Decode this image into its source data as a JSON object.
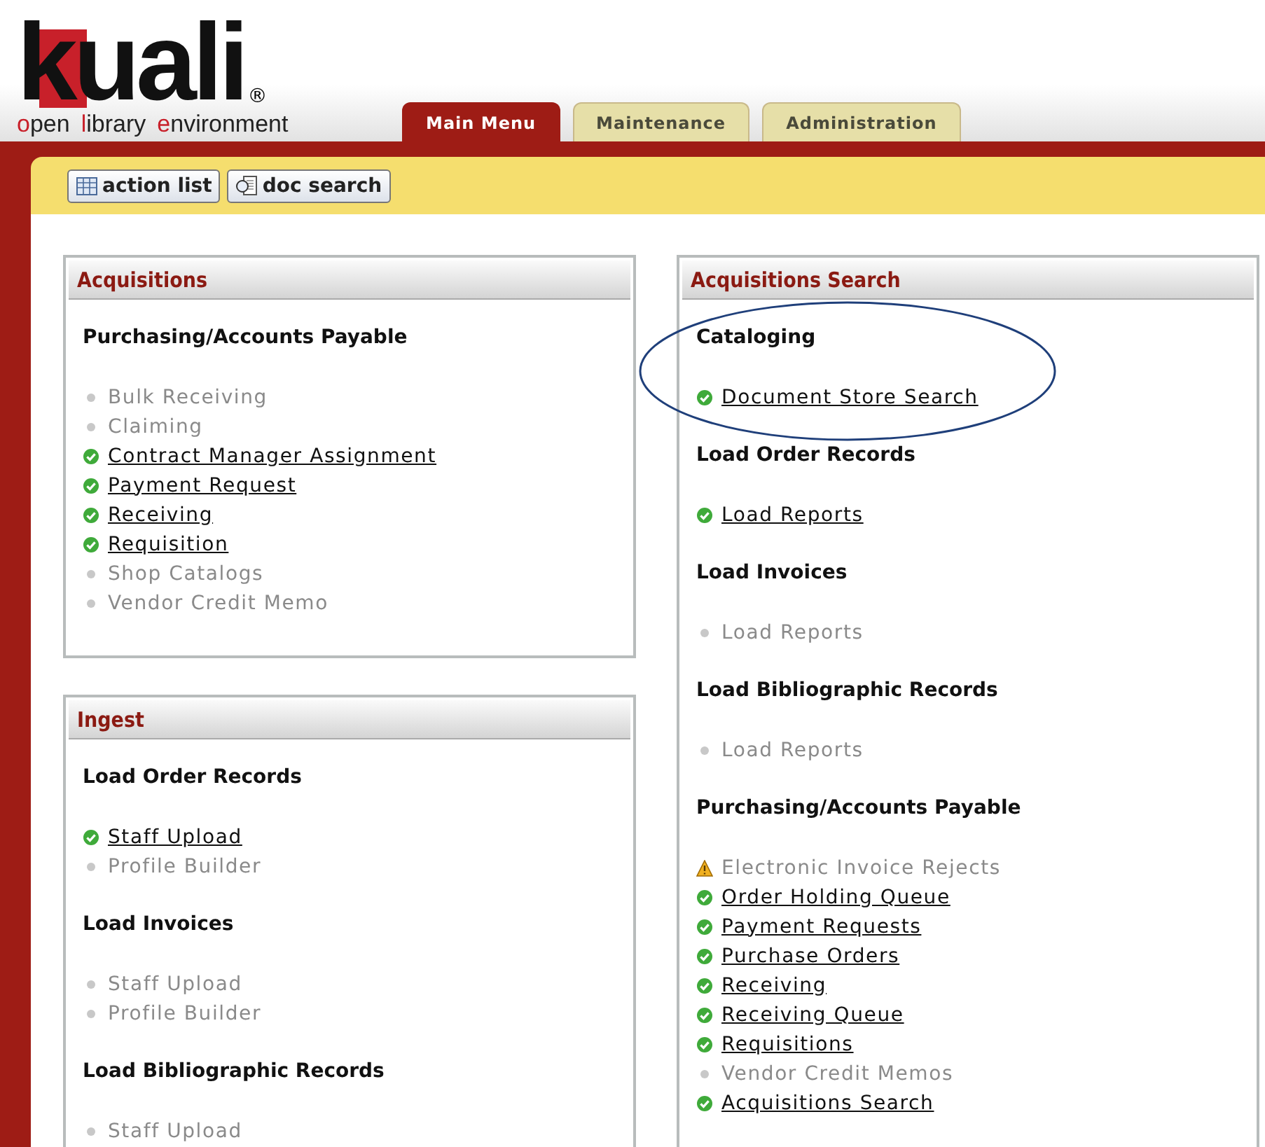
{
  "logo": {
    "wordmark": "kuali",
    "registered": "®",
    "tagline": [
      "open",
      "library",
      "environment"
    ]
  },
  "tabs": [
    {
      "label": "Main Menu",
      "selected": true
    },
    {
      "label": "Maintenance",
      "selected": false
    },
    {
      "label": "Administration",
      "selected": false
    }
  ],
  "toolbar": [
    {
      "label": "action list",
      "kind": "list"
    },
    {
      "label": "doc search",
      "kind": "search"
    }
  ],
  "left_panels": [
    {
      "title": "Acquisitions",
      "sections": [
        {
          "heading": "Purchasing/Accounts Payable",
          "items": [
            {
              "label": "Bulk Receiving",
              "kind": "disabled"
            },
            {
              "label": "Claiming",
              "kind": "disabled"
            },
            {
              "label": "Contract Manager Assignment",
              "kind": "link"
            },
            {
              "label": "Payment Request",
              "kind": "link"
            },
            {
              "label": "Receiving",
              "kind": "link"
            },
            {
              "label": "Requisition",
              "kind": "link"
            },
            {
              "label": "Shop Catalogs",
              "kind": "disabled"
            },
            {
              "label": "Vendor Credit Memo",
              "kind": "disabled"
            }
          ]
        }
      ]
    },
    {
      "title": "Ingest",
      "sections": [
        {
          "heading": "Load Order Records",
          "items": [
            {
              "label": "Staff Upload",
              "kind": "link"
            },
            {
              "label": "Profile Builder",
              "kind": "disabled"
            }
          ]
        },
        {
          "heading": "Load Invoices",
          "items": [
            {
              "label": "Staff Upload",
              "kind": "disabled"
            },
            {
              "label": "Profile Builder",
              "kind": "disabled"
            }
          ]
        },
        {
          "heading": "Load Bibliographic Records",
          "items": [
            {
              "label": "Staff Upload",
              "kind": "disabled"
            }
          ]
        }
      ]
    }
  ],
  "right_panels": [
    {
      "title": "Acquisitions Search",
      "sections": [
        {
          "heading": "Cataloging",
          "items": [
            {
              "label": "Document Store Search",
              "kind": "link"
            }
          ]
        },
        {
          "heading": "Load Order Records",
          "items": [
            {
              "label": "Load Reports",
              "kind": "link"
            }
          ]
        },
        {
          "heading": "Load Invoices",
          "items": [
            {
              "label": "Load Reports",
              "kind": "disabled"
            }
          ]
        },
        {
          "heading": "Load Bibliographic Records",
          "items": [
            {
              "label": "Load Reports",
              "kind": "disabled"
            }
          ]
        },
        {
          "heading": "Purchasing/Accounts Payable",
          "items": [
            {
              "label": "Electronic Invoice Rejects",
              "kind": "warning"
            },
            {
              "label": "Order Holding Queue",
              "kind": "link"
            },
            {
              "label": "Payment Requests",
              "kind": "link"
            },
            {
              "label": "Purchase Orders",
              "kind": "link"
            },
            {
              "label": "Receiving",
              "kind": "link"
            },
            {
              "label": "Receiving Queue",
              "kind": "link"
            },
            {
              "label": "Requisitions",
              "kind": "link"
            },
            {
              "label": "Vendor Credit Memos",
              "kind": "disabled"
            },
            {
              "label": "Acquisitions Search",
              "kind": "link"
            }
          ]
        }
      ]
    }
  ]
}
